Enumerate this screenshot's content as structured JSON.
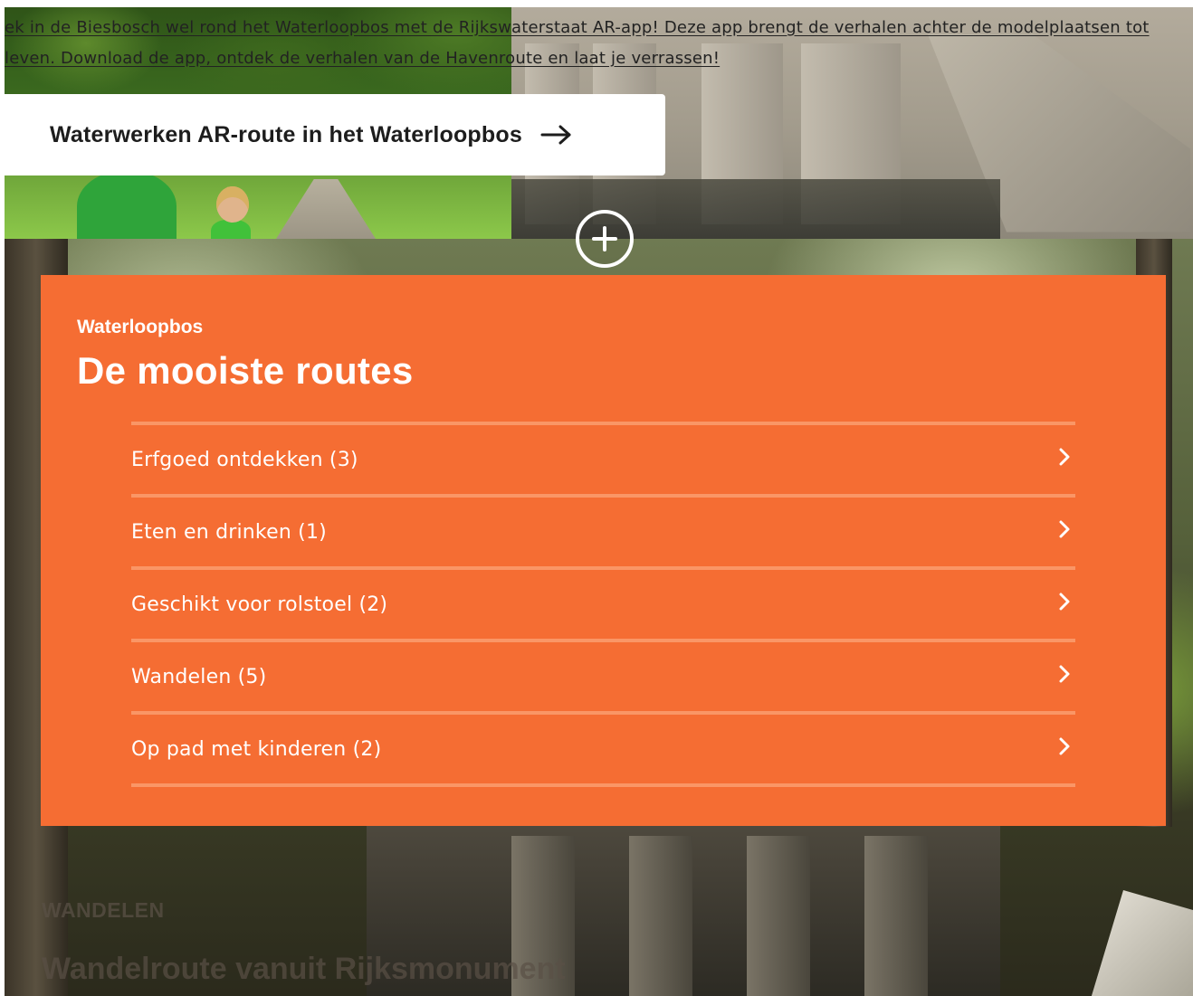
{
  "hero": {
    "text": "ek in de Biesbosch wel rond het Waterloopbos met de Rijkswaterstaat AR-app! Deze app brengt de verhalen achter de modelplaatsen tot leven. Download de app, ontdek de verhalen van de Havenroute en laat je verrassen!",
    "cta_label": "Waterwerken AR-route in het Waterloopbos"
  },
  "routes": {
    "eyebrow": "Waterloopbos",
    "title": "De mooiste routes",
    "items": [
      {
        "label": "Erfgoed ontdekken (3)"
      },
      {
        "label": "Eten en drinken (1)"
      },
      {
        "label": "Geschikt voor rolstoel (2)"
      },
      {
        "label": "Wandelen (5)"
      },
      {
        "label": "Op pad met kinderen (2)"
      }
    ]
  },
  "teaser": {
    "category": "WANDELEN",
    "title": "Wandelroute vanuit Rijksmonument"
  },
  "colors": {
    "panel": "#f56d33",
    "divider": "#fa9666",
    "text_light": "#ffffff"
  }
}
